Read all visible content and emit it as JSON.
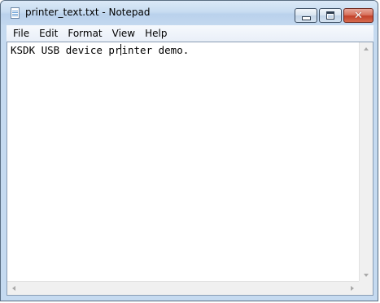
{
  "window": {
    "title": "printer_text.txt - Notepad",
    "icon": "notepad-icon",
    "controls": {
      "minimize": "minimize-icon",
      "maximize": "maximize-icon",
      "close": "close-icon",
      "close_glyph": "✕"
    }
  },
  "menu": {
    "items": [
      {
        "label": "File"
      },
      {
        "label": "Edit"
      },
      {
        "label": "Format"
      },
      {
        "label": "View"
      },
      {
        "label": "Help"
      }
    ]
  },
  "editor": {
    "text_before_caret": "KSDK USB device pr",
    "text_after_caret": "inter demo."
  },
  "colors": {
    "titlebar": "#c8dcf1",
    "close_button": "#c2412a",
    "editor_bg": "#ffffff"
  }
}
